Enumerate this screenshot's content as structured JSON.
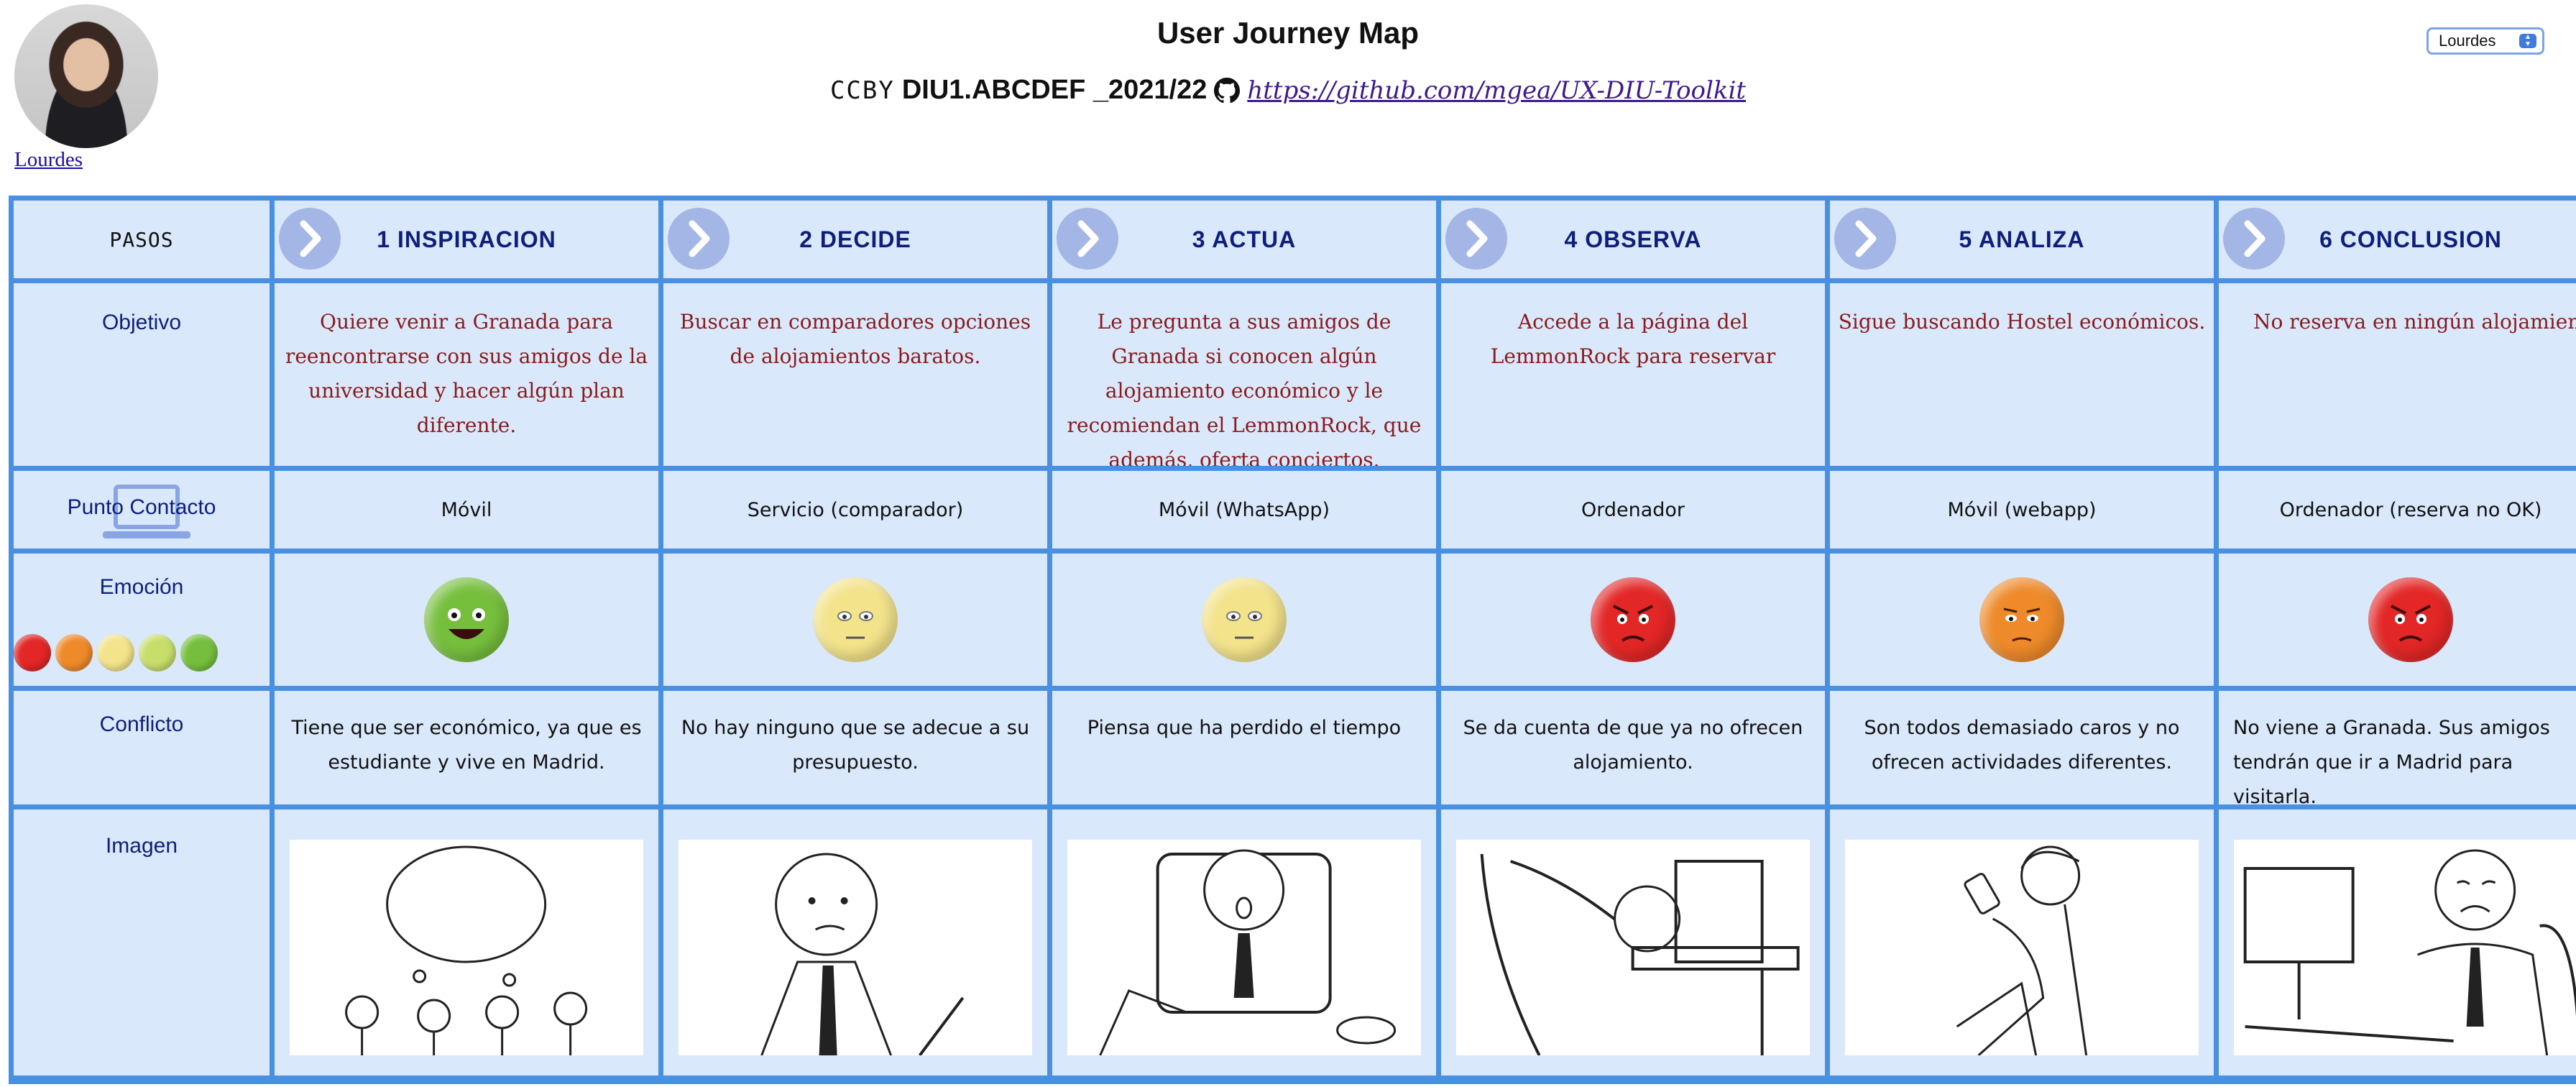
{
  "header": {
    "title": "User Journey Map",
    "license": "CCBY",
    "course_code": "DIU1.ABCDEF _2021/22",
    "repo_link": "https://github.com/mgea/UX-DIU-Toolkit",
    "persona_link": "Lourdes",
    "persona_select_value": "Lourdes"
  },
  "row_labels": {
    "pasos": "PASOS",
    "objetivo": "Objetivo",
    "contacto": "Punto Contacto",
    "emocion": "Emoción",
    "conflicto": "Conflicto",
    "imagen": "Imagen"
  },
  "steps": [
    {
      "label": "1 INSPIRACION",
      "objetivo": "Quiere venir a Granada para reencontrarse con sus amigos de la universidad y hacer algún plan diferente.",
      "contacto": "Móvil",
      "emocion": "happy",
      "conflicto": "Tiene que ser económico, ya que es estudiante y vive en Madrid."
    },
    {
      "label": "2 DECIDE",
      "objetivo": "Buscar en comparadores opciones de alojamientos baratos.",
      "contacto": "Servicio (comparador)",
      "emocion": "neutral",
      "conflicto": "No hay ninguno que se adecue a su presupuesto."
    },
    {
      "label": "3 ACTUA",
      "objetivo": "Le pregunta a sus amigos de Granada si conocen algún alojamiento económico y le recomiendan el LemmonRock, que además, oferta conciertos.",
      "contacto": "Móvil (WhatsApp)",
      "emocion": "neutral",
      "conflicto": "Piensa que ha perdido el tiempo"
    },
    {
      "label": "4 OBSERVA",
      "objetivo": "Accede a la página del LemmonRock para reservar",
      "contacto": "Ordenador",
      "emocion": "angry",
      "conflicto": "Se da cuenta de que ya no ofrecen alojamiento."
    },
    {
      "label": "5 ANALIZA",
      "objetivo": "Sigue buscando Hostel económicos.",
      "contacto": "Móvil (webapp)",
      "emocion": "annoyed",
      "conflicto": "Son todos demasiado caros y no ofrecen actividades diferentes."
    },
    {
      "label": "6 CONCLUSION",
      "objetivo": "No reserva en ningún alojamiento.",
      "contacto": "Ordenador (reserva no OK)",
      "emocion": "angry",
      "conflicto": "No viene a Granada. Sus amigos tendrán que ir a Madrid para visitarla."
    }
  ],
  "icons": {
    "step_chevron": "chevron-right-icon",
    "contact_decoration": "laptop-icon",
    "repo": "github-icon"
  },
  "emotion_colors": {
    "angry": "#e32626",
    "annoyed": "#ee8a2a",
    "neutral": "#f3e38a",
    "slightly_happy": "#c8de6a",
    "happy": "#76bf3d"
  },
  "colors": {
    "grid_border": "#4a90e2",
    "cell_bg": "#d9e8fb",
    "label_text": "#0d1f7a",
    "objective_text": "#8b1a1a"
  }
}
